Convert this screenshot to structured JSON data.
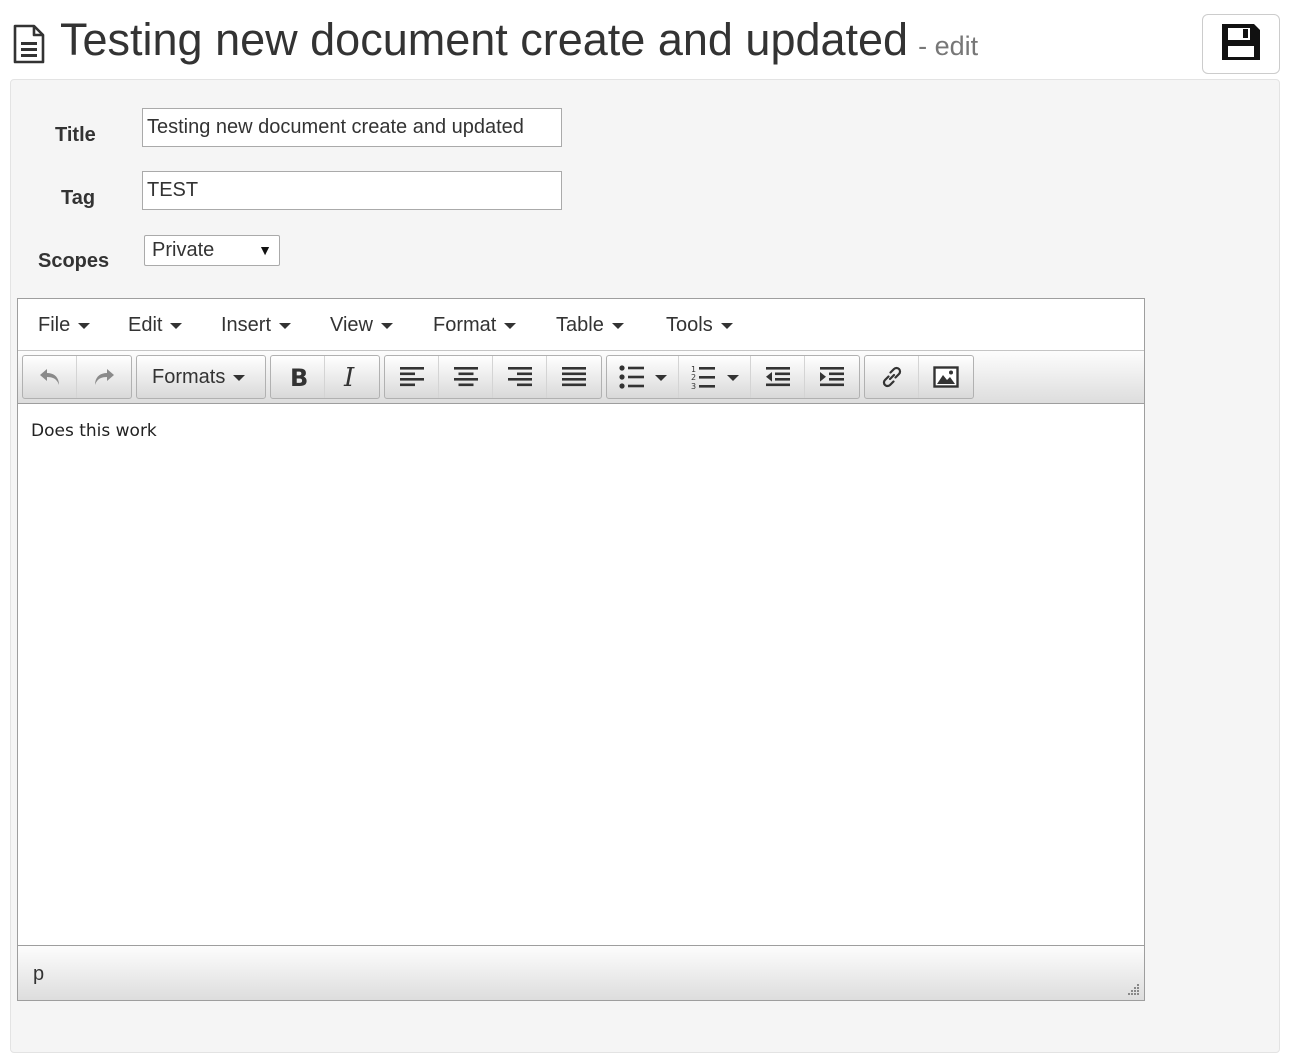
{
  "header": {
    "title": "Testing new document create and updated",
    "subtitle": "- edit",
    "icon": "document-icon",
    "save_icon": "floppy-disk-icon"
  },
  "form": {
    "title_label": "Title",
    "title_value": "Testing new document create and updated",
    "tag_label": "Tag",
    "tag_value": "TEST",
    "scopes_label": "Scopes",
    "scopes_selected": "Private"
  },
  "editor": {
    "menu": [
      "File",
      "Edit",
      "Insert",
      "View",
      "Format",
      "Table",
      "Tools"
    ],
    "formats_label": "Formats",
    "toolbar_icons": [
      "undo-icon",
      "redo-icon",
      "bold-icon",
      "italic-icon",
      "align-left-icon",
      "align-center-icon",
      "align-right-icon",
      "align-justify-icon",
      "bullet-list-icon",
      "numbered-list-icon",
      "outdent-icon",
      "indent-icon",
      "link-icon",
      "image-icon"
    ],
    "content": "Does this work",
    "path": "p"
  }
}
